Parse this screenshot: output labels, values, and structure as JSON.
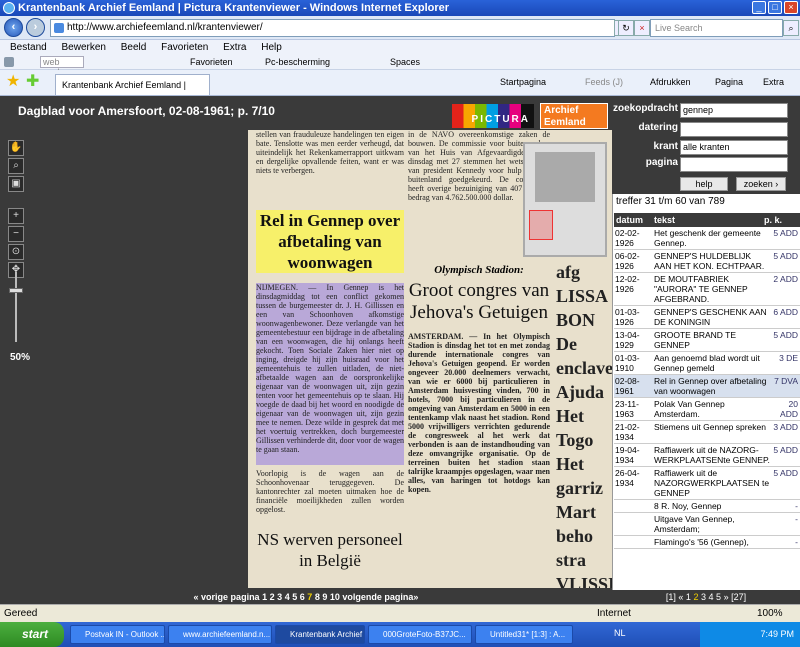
{
  "window": {
    "title": "Krantenbank Archief Eemland | Pictura Krantenviewer - Windows Internet Explorer"
  },
  "address": {
    "url": "http://www.archiefeemland.nl/krantenviewer/",
    "search_placeholder": "Live Search"
  },
  "menu": [
    "Bestand",
    "Bewerken",
    "Beeld",
    "Favorieten",
    "Extra",
    "Help"
  ],
  "linksbar": {
    "search": "web zoeken...",
    "favorieten": "Favorieten",
    "pc": "Pc-bescherming",
    "spaces": "Spaces"
  },
  "favbar": {
    "tab": "Krantenbank Archief Eemland | Pictura Krantenviewer",
    "startpagina": "Startpagina",
    "feeds": "Feeds (J)",
    "afdrukken": "Afdrukken",
    "pagina": "Pagina",
    "extra": "Extra"
  },
  "viewer": {
    "title": "Dagblad voor Amersfoort, 02-08-1961; p. 7/10",
    "logo1": "PICTURA",
    "logo2a": "Archief",
    "logo2b": "Eemland",
    "zoom": "50%"
  },
  "article": {
    "col1_top": "stellen van frauduleuze handelingen ten eigen bate. Tenslotte was men eerder verheugd, dat uiteindelijk het Rekenkamerrapport uitkwam en dergelijke opvallende feiten, want er was niets te verbergen.",
    "headline": "Rel in Gennep over afbetaling van woonwagen",
    "body1": "NIJMEGEN. — In Gennep is het dinsdagmiddag tot een conflict gekomen tussen de burgemeester dr. J. H. Gillissen en een van Schoonhoven afkomstige woonwagenbewoner. Deze verlangde van het gemeentebestuur een bijdrage in de afbetaling van een woonwagen, die hij onlangs heeft gekocht. Toen Sociale Zaken hier niet op inging, dreigde hij zijn huisraad voor het gemeentehuis te zullen uitladen, de niet-afbetaalde wagen aan de oorspronkelijke eigenaar van de woonwagen uit, zijn gezin tenten voor het gemeentehuis op te slaan. Hij voegde de daad bij het woord en noodigde de eigenaar van de woonwagen uit, zijn gezin mee te nemen. Deze wilde in gesprek dat met het voertuig vertrekken, doch burgemeester Gillissen verhinderde dit, door voor de wagen te gaan staan.",
    "body2": "Voorlopig is de wagen aan de Schoonhovenaar teruggegeven. De kantonrechter zal moeten uitmaken hoe de financiële moeilijkheden zullen worden opgelost.",
    "headline_b": "NS werven personeel in België",
    "col2_top": "in de NAVO overeenkomstige zaken de bouwen. De commissie voor buiten zaken van het Huis van Afgevaardigden heeft dinsdag met 27 stemmen het wetsontwerp van president Kennedy voor hulp aan het buitenland goedgekeurd. De commissie heeft overige bezuiniging van 407 miljoen bedrag van 4.762.500.000 dollar.",
    "kicker": "Olympisch Stadion:",
    "headline2": "Groot congres van Jehova's Getuigen",
    "body3": "AMSTERDAM. — In het Olympisch Stadion is dinsdag het tot en met zondag durende internationale congres van Jehova's Getuigen geopend. Er worden ongeveer 20.000 deelnemers verwacht, van wie er 6000 bij particulieren in Amsterdam huisvesting vinden, 700 in hotels, 7000 bij particulieren in de omgeving van Amsterdam en 5000 in een tentenkamp vlak naast het stadion. Rond 5000 vrijwilligers verrichten gedurende de congresweek al het werk dat verbonden is aan de instandhouding van deze omvangrijke organisatie. Op de terreinen buiten het stadion staan talrijke kraampjes opgeslagen, waar men alles, van haringen tot hotdogs kan kopen.",
    "col3": "afg LISSABON De enclave Ajuda Het Togo Het garriz Mart beho stra VLISSINGEN Walcheren"
  },
  "pager": {
    "prev": "« vorige pagina",
    "pages": [
      "1",
      "2",
      "3",
      "4",
      "5",
      "6",
      "7",
      "8",
      "9",
      "10"
    ],
    "current": "7",
    "next": "volgende pagina»"
  },
  "search": {
    "zoekopdracht_label": "zoekopdracht",
    "zoekopdracht_value": "gennep",
    "datering_label": "datering",
    "krant_label": "krant",
    "krant_value": "alle kranten",
    "pagina_label": "pagina",
    "help": "help",
    "zoeken": "zoeken ›",
    "treffer": "treffer 31 t/m 60 van 789",
    "cols": {
      "datum": "datum",
      "tekst": "tekst",
      "pk": "p. k."
    }
  },
  "results": [
    {
      "d": "02-02-1926",
      "t": "Het geschenk der gemeente Gennep.",
      "p": "5 ADD"
    },
    {
      "d": "06-02-1926",
      "t": "GENNEP'S HULDEBLIJK AAN HET KON. ECHTPAAR.",
      "p": "5 ADD"
    },
    {
      "d": "12-02-1926",
      "t": "DE MOUTFABRIEK \"AURORA\" TE GENNEP AFGEBRAND.",
      "p": "2 ADD"
    },
    {
      "d": "01-03-1926",
      "t": "GENNEP'S GESCHENK AAN DE KONINGIN",
      "p": "6 ADD"
    },
    {
      "d": "13-04-1929",
      "t": "GROOTE BRAND TE GENNEP",
      "p": "5 ADD"
    },
    {
      "d": "01-03-1910",
      "t": "Aan genoemd blad wordt uit Gennep gemeld",
      "p": "3 DE"
    },
    {
      "d": "02-08-1961",
      "t": "Rel in Gennep over afbetaling van woonwagen",
      "p": "7 DVA"
    },
    {
      "d": "23-11-1963",
      "t": "Polak Van Gennep Amsterdam.",
      "p": "20 ADD"
    },
    {
      "d": "21-02-1934",
      "t": "Stiemens uit Gennep spreken",
      "p": "3 ADD"
    },
    {
      "d": "19-04-1934",
      "t": "Raffiawerk uit de NAZORG-WERKPLAATSENte GENNEP.",
      "p": "5 ADD"
    },
    {
      "d": "26-04-1934",
      "t": "Raffiawerk uit de NAZORGWERKPLAATSEN te GENNEP",
      "p": "5 ADD"
    },
    {
      "d": "",
      "t": "8 R. Noy, Gennep",
      "p": "-"
    },
    {
      "d": "",
      "t": "Uitgave Van Gennep, Amsterdam;",
      "p": "-"
    },
    {
      "d": "",
      "t": "Flamingo's '56 (Gennep),",
      "p": "-"
    }
  ],
  "spager": {
    "text1": "[1] «",
    "pages": [
      "1",
      "2",
      "3",
      "4",
      "5"
    ],
    "current": "2",
    "text2": "» [27]"
  },
  "status": {
    "left": "Gereed",
    "zone": "Internet",
    "zoom": "100%"
  },
  "taskbar": {
    "start": "start",
    "items": [
      "Postvak IN - Outlook ...",
      "www.archiefeemland.n...",
      "Krantenbank Archief ...",
      "000GroteFoto-B37JC...",
      "Untitled31* [1:3] : A..."
    ],
    "lang": "NL",
    "time": "7:49 PM"
  }
}
